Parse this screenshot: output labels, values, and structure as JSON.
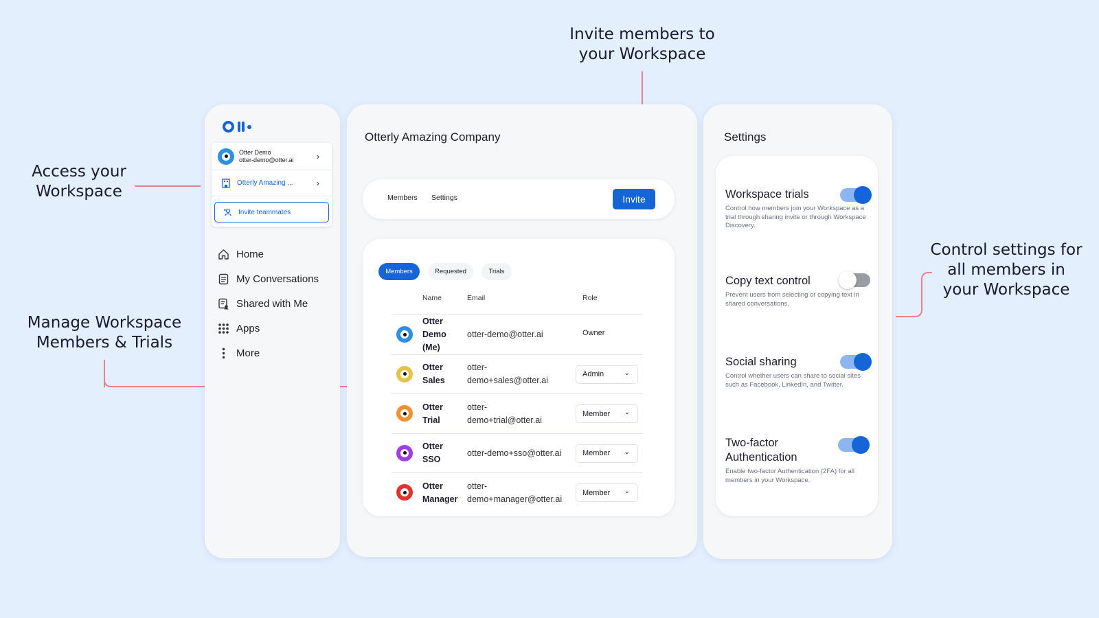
{
  "callouts": {
    "invite": [
      "Invite members to",
      "your Workspace"
    ],
    "access": [
      "Access your",
      "Workspace"
    ],
    "manage": [
      "Manage Workspace",
      "Members & Trials"
    ],
    "control": [
      "Control settings for",
      "all members in",
      "your Workspace"
    ]
  },
  "sidebar": {
    "user_name": "Otter Demo",
    "user_email": "otter-demo@otter.ai",
    "workspace_name": "Otterly Amazing ...",
    "invite_label": "Invite teammates",
    "nav": [
      {
        "label": "Home",
        "icon": "home-icon"
      },
      {
        "label": "My Conversations",
        "icon": "conversations-icon"
      },
      {
        "label": "Shared with Me",
        "icon": "shared-icon"
      },
      {
        "label": "Apps",
        "icon": "apps-icon"
      },
      {
        "label": "More",
        "icon": "more-icon"
      }
    ]
  },
  "main": {
    "company": "Otterly Amazing Company",
    "tabs": [
      "Members",
      "Settings"
    ],
    "invite_label": "Invite",
    "filters": [
      "Members",
      "Requested",
      "Trials"
    ],
    "columns": [
      "Name",
      "Email",
      "Role"
    ],
    "members": [
      {
        "name": [
          "Otter",
          "Demo",
          "(Me)"
        ],
        "email": [
          "otter-demo@otter.ai"
        ],
        "role": "Owner",
        "editable": false,
        "color": "#2f8fe0"
      },
      {
        "name": [
          "Otter",
          "Sales"
        ],
        "email": [
          "otter-",
          "demo+sales@otter.ai"
        ],
        "role": "Admin",
        "editable": true,
        "color": "#e3c54a"
      },
      {
        "name": [
          "Otter",
          "Trial"
        ],
        "email": [
          "otter-",
          "demo+trial@otter.ai"
        ],
        "role": "Member",
        "editable": true,
        "color": "#f0922f"
      },
      {
        "name": [
          "Otter",
          "SSO"
        ],
        "email": [
          "otter-demo+sso@otter.ai"
        ],
        "role": "Member",
        "editable": true,
        "color": "#a23fe0"
      },
      {
        "name": [
          "Otter",
          "Manager"
        ],
        "email": [
          "otter-",
          "demo+manager@otter.ai"
        ],
        "role": "Member",
        "editable": true,
        "color": "#e0342f"
      }
    ]
  },
  "settings": {
    "title": "Settings",
    "items": [
      {
        "title": "Workspace trials",
        "desc": "Control how members join your Workspace as a trial through sharing invite or through Workspace Discovery.",
        "enabled": true
      },
      {
        "title": "Copy text control",
        "desc": "Prevent users from selecting or copying text in shared conversations.",
        "enabled": false
      },
      {
        "title": "Social sharing",
        "desc": "Control whether users can share to social sites such as Facebook, LinkedIn, and Twitter.",
        "enabled": true
      },
      {
        "title": "Two-factor Authentication",
        "desc": "Enable two-factor Authentication (2FA) for all members in your Workspace.",
        "enabled": true
      }
    ]
  },
  "colors": {
    "accent": "#1565d8",
    "callout_line": "#e77f8e",
    "background": "#e3effd"
  }
}
